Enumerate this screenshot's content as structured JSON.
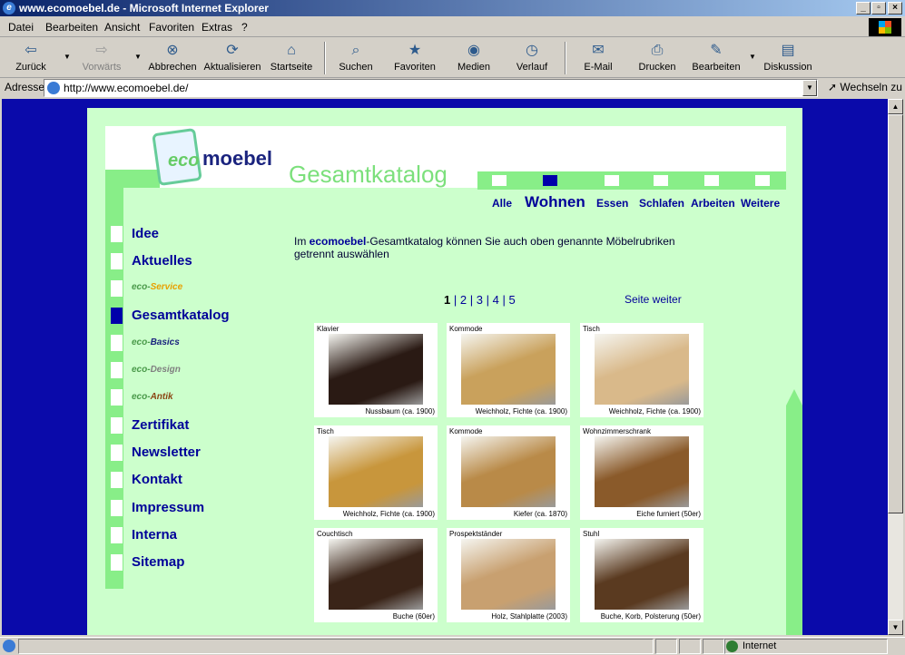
{
  "window": {
    "title": "www.ecomoebel.de - Microsoft Internet Explorer"
  },
  "menu": [
    "Datei",
    "Bearbeiten",
    "Ansicht",
    "Favoriten",
    "Extras",
    "?"
  ],
  "toolbar": {
    "back": "Zurück",
    "forward": "Vorwärts",
    "stop": "Abbrechen",
    "refresh": "Aktualisieren",
    "home": "Startseite",
    "search": "Suchen",
    "favorites": "Favoriten",
    "media": "Medien",
    "history": "Verlauf",
    "mail": "E-Mail",
    "print": "Drucken",
    "edit": "Bearbeiten",
    "discuss": "Diskussion"
  },
  "address": {
    "label": "Adresse",
    "url": "http://www.ecomoebel.de/",
    "go": "Wechseln zu"
  },
  "site": {
    "logo_eco": "eco",
    "logo_moebel": "moebel",
    "title": "Gesamtkatalog",
    "categories": [
      {
        "label": "Alle",
        "active": false
      },
      {
        "label": "Wohnen",
        "active": true
      },
      {
        "label": "Essen",
        "active": false
      },
      {
        "label": "Schlafen",
        "active": false
      },
      {
        "label": "Arbeiten",
        "active": false
      },
      {
        "label": "Weitere",
        "active": false
      }
    ],
    "nav": [
      {
        "label": "Idee"
      },
      {
        "label": "Aktuelles"
      },
      {
        "logo": "Service",
        "color": "#e8a000"
      },
      {
        "label": "Gesamtkatalog",
        "active": true
      },
      {
        "logo": "Basics",
        "color": "#1a237e"
      },
      {
        "logo": "Design",
        "color": "#808080"
      },
      {
        "logo": "Antik",
        "color": "#8b4513"
      },
      {
        "label": "Zertifikat"
      },
      {
        "label": "Newsletter"
      },
      {
        "label": "Kontakt"
      },
      {
        "label": "Impressum"
      },
      {
        "label": "Interna"
      },
      {
        "label": "Sitemap"
      }
    ],
    "nav_eco": "eco-",
    "intro_pre": "Im ",
    "intro_brand": "ecomoebel",
    "intro_post": "-Gesamtkatalog können Sie auch oben genannte Möbelrubriken getrennt auswählen",
    "pager": {
      "current": "1",
      "pages": [
        "2",
        "3",
        "4",
        "5"
      ],
      "sep": "|",
      "next": "Seite weiter"
    },
    "products": [
      {
        "name": "Klavier",
        "caption": "Nussbaum (ca. 1900)",
        "color": "#2a1a14"
      },
      {
        "name": "Kommode",
        "caption": "Weichholz, Fichte (ca. 1900)",
        "color": "#c9a15c"
      },
      {
        "name": "Tisch",
        "caption": "Weichholz, Fichte (ca. 1900)",
        "color": "#d9b98a"
      },
      {
        "name": "Tisch",
        "caption": "Weichholz, Fichte (ca. 1900)",
        "color": "#c8963c"
      },
      {
        "name": "Kommode",
        "caption": "Kiefer (ca. 1870)",
        "color": "#b98a48"
      },
      {
        "name": "Wohnzimmerschrank",
        "caption": "Eiche furniert (50er)",
        "color": "#8a5a2a"
      },
      {
        "name": "Couchtisch",
        "caption": "Buche (60er)",
        "color": "#3a2418"
      },
      {
        "name": "Prospektständer",
        "caption": "Holz, Stahlplatte (2003)",
        "color": "#c8a070"
      },
      {
        "name": "Stuhl",
        "caption": "Buche, Korb, Polsterung (50er)",
        "color": "#5a3a20"
      }
    ]
  },
  "status": {
    "zone": "Internet"
  }
}
